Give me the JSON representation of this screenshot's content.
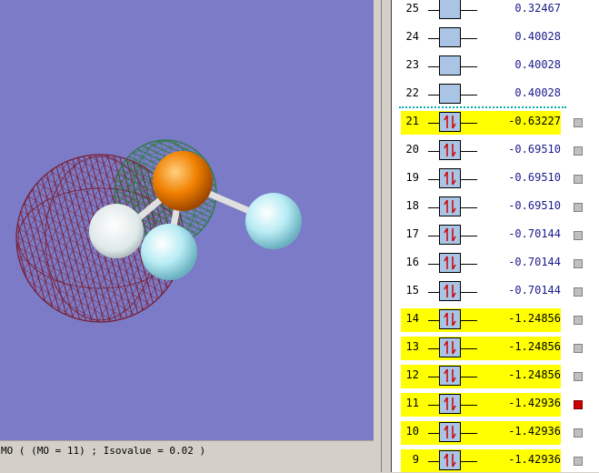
{
  "status_text": "MO ( (MO = 11) ; Isovalue = 0.02 )",
  "viewport": {
    "background_color": "#7b7bc8",
    "atoms": [
      {
        "name": "central-atom",
        "color": "#f08000"
      },
      {
        "name": "h-atom",
        "color": "#b8ecf4"
      }
    ],
    "orbital_lobes": [
      {
        "name": "lobe-red",
        "color": "#7a1a2a"
      },
      {
        "name": "lobe-green",
        "color": "#2a7a3a"
      }
    ]
  },
  "mo_list": [
    {
      "num": "25",
      "energy": "0.32467",
      "occupied": false,
      "highlight": false,
      "selected": false,
      "checkbox": false
    },
    {
      "num": "24",
      "energy": "0.40028",
      "occupied": false,
      "highlight": false,
      "selected": false,
      "checkbox": false
    },
    {
      "num": "23",
      "energy": "0.40028",
      "occupied": false,
      "highlight": false,
      "selected": false,
      "checkbox": false
    },
    {
      "num": "22",
      "energy": "0.40028",
      "occupied": false,
      "highlight": false,
      "selected": false,
      "checkbox": false
    },
    {
      "num": "21",
      "energy": "-0.63227",
      "occupied": true,
      "highlight": true,
      "selected": false,
      "checkbox": true
    },
    {
      "num": "20",
      "energy": "-0.69510",
      "occupied": true,
      "highlight": false,
      "selected": false,
      "checkbox": true
    },
    {
      "num": "19",
      "energy": "-0.69510",
      "occupied": true,
      "highlight": false,
      "selected": false,
      "checkbox": true
    },
    {
      "num": "18",
      "energy": "-0.69510",
      "occupied": true,
      "highlight": false,
      "selected": false,
      "checkbox": true
    },
    {
      "num": "17",
      "energy": "-0.70144",
      "occupied": true,
      "highlight": false,
      "selected": false,
      "checkbox": true
    },
    {
      "num": "16",
      "energy": "-0.70144",
      "occupied": true,
      "highlight": false,
      "selected": false,
      "checkbox": true
    },
    {
      "num": "15",
      "energy": "-0.70144",
      "occupied": true,
      "highlight": false,
      "selected": false,
      "checkbox": true
    },
    {
      "num": "14",
      "energy": "-1.24856",
      "occupied": true,
      "highlight": true,
      "selected": false,
      "checkbox": true
    },
    {
      "num": "13",
      "energy": "-1.24856",
      "occupied": true,
      "highlight": true,
      "selected": false,
      "checkbox": true
    },
    {
      "num": "12",
      "energy": "-1.24856",
      "occupied": true,
      "highlight": true,
      "selected": false,
      "checkbox": true
    },
    {
      "num": "11",
      "energy": "-1.42936",
      "occupied": true,
      "highlight": true,
      "selected": true,
      "checkbox": true
    },
    {
      "num": "10",
      "energy": "-1.42936",
      "occupied": true,
      "highlight": true,
      "selected": false,
      "checkbox": true
    },
    {
      "num": "9",
      "energy": "-1.42936",
      "occupied": true,
      "highlight": true,
      "selected": false,
      "checkbox": true
    }
  ],
  "colors": {
    "highlight": "#ffff00",
    "energy_text": "#1a1a8c",
    "orbital_box": "#a9c4e4",
    "electron_arrow": "#cc0000",
    "selected_check": "#cc0000",
    "homo_lumo_separator": "#00b0b0"
  }
}
